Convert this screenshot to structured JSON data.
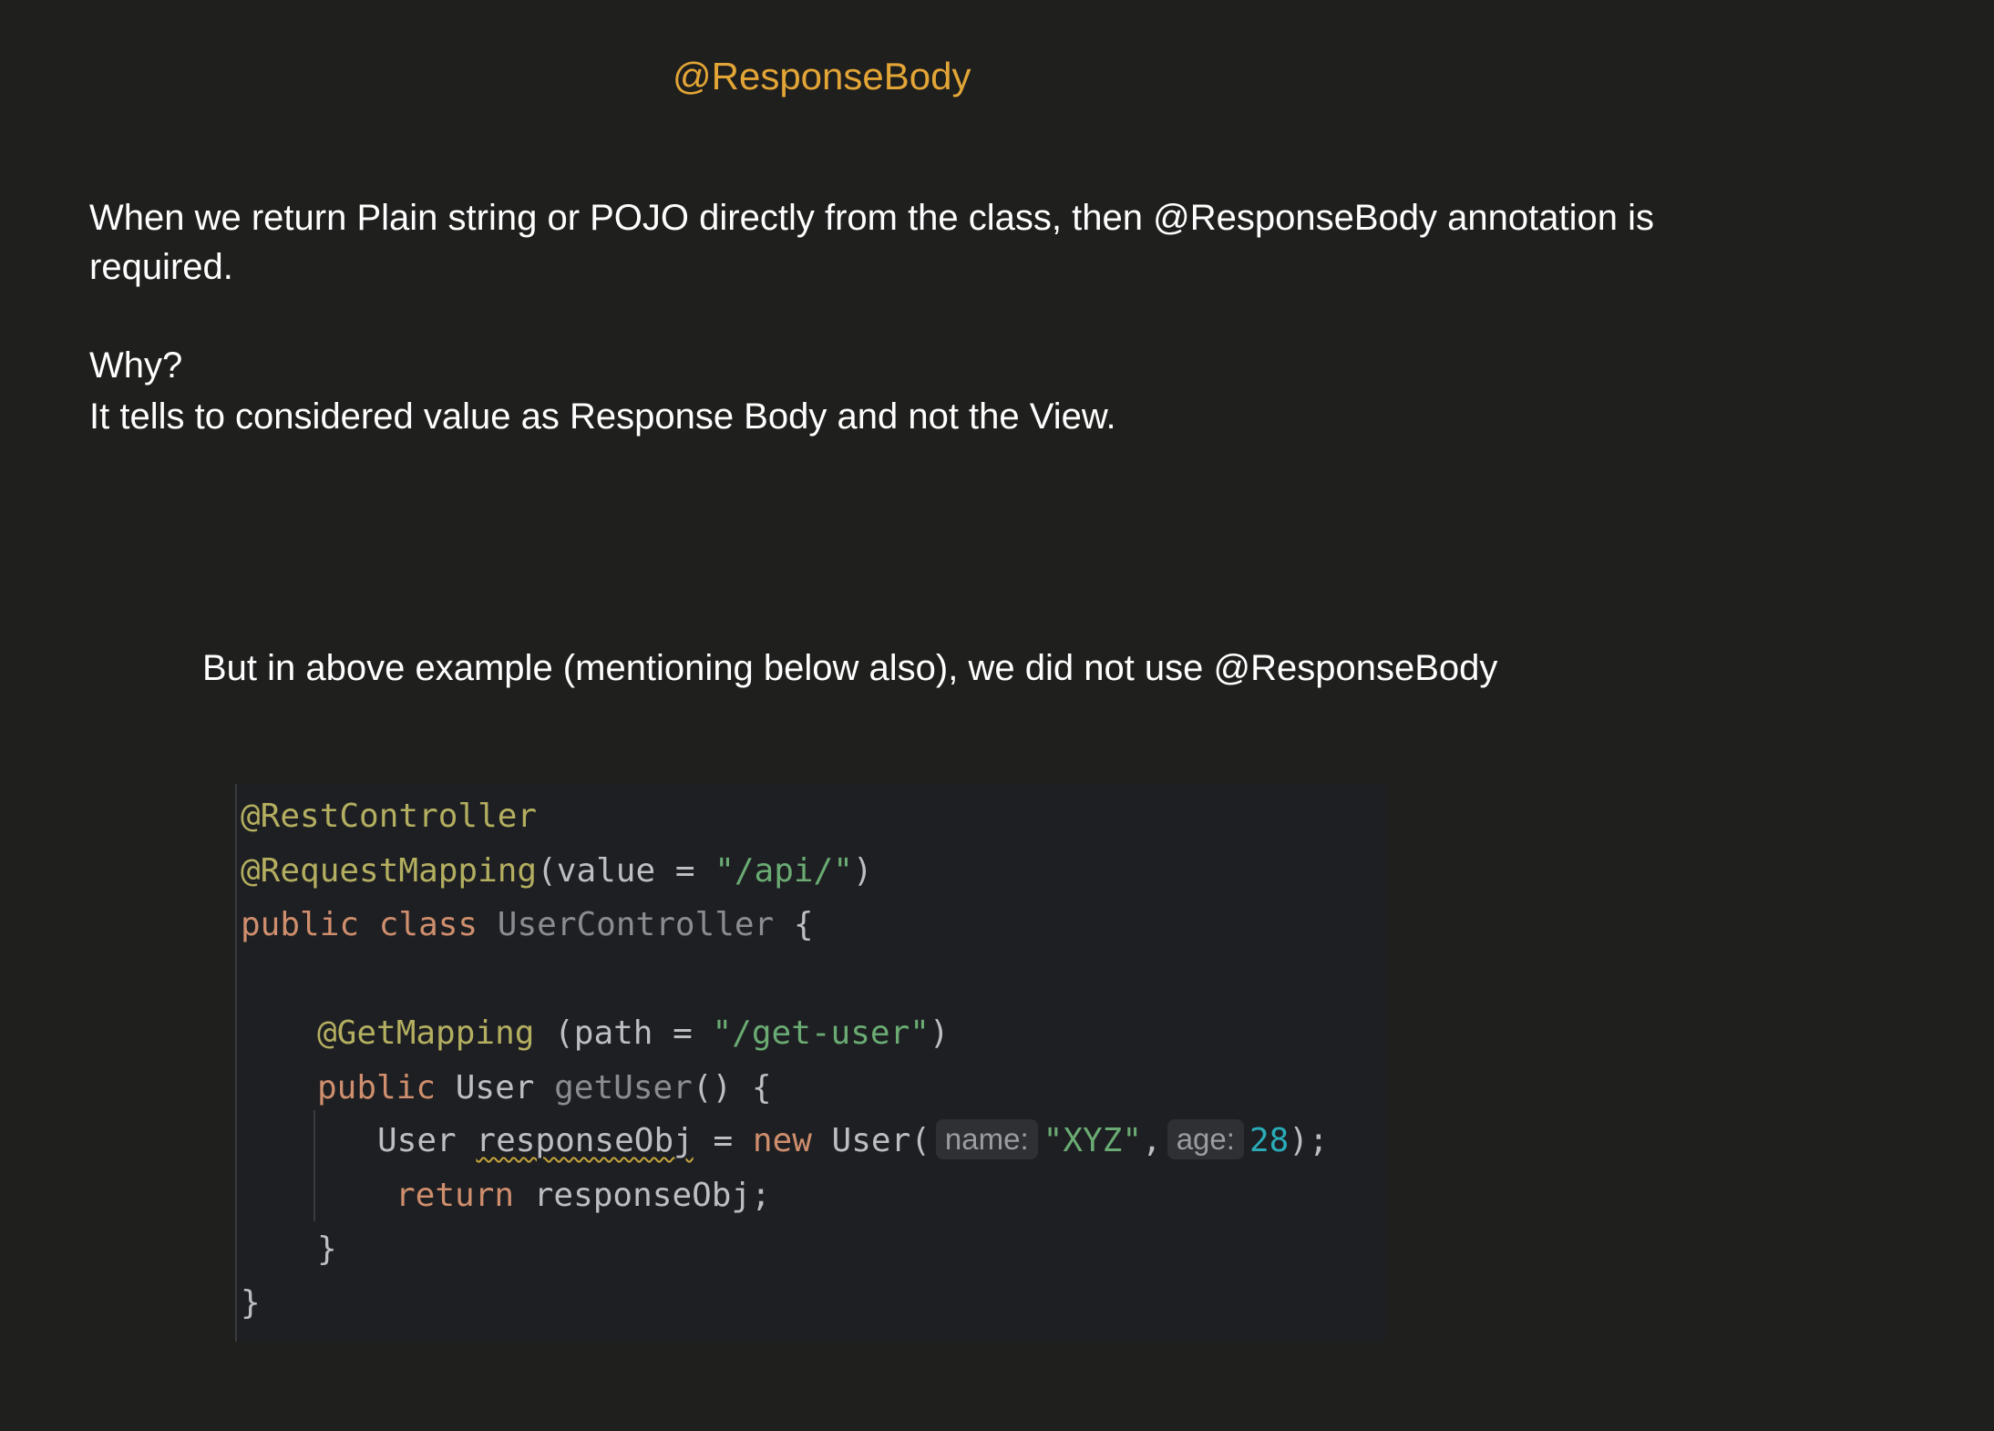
{
  "title": "@ResponseBody",
  "intro": {
    "line1": "When we return Plain string or POJO directly from the class, then @ResponseBody annotation is",
    "line2": "required."
  },
  "why": {
    "heading": "Why?",
    "answer": "It tells to considered value as Response Body and not the View."
  },
  "note": "But in above example (mentioning below also), we did not use @ResponseBody",
  "code": {
    "l1": {
      "ann": "@RestController"
    },
    "l2": {
      "ann": "@RequestMapping",
      "open": "(value = ",
      "str": "\"/api/\"",
      "close": ")"
    },
    "l3": {
      "kw1": "public",
      "kw2": "class",
      "cls": "UserController",
      "brace": "{"
    },
    "l4": {
      "ann": "@GetMapping",
      "open": " (path = ",
      "str": "\"/get-user\"",
      "close": ")"
    },
    "l5": {
      "kw": "public",
      "type": "User",
      "fn": "getUser",
      "rest": "() {"
    },
    "l6": {
      "type": "User",
      "var": "responseObj",
      "eq": " = ",
      "kw": "new",
      "ctor": " User(",
      "hint1": "name:",
      "str": "\"XYZ\"",
      "comma": ",",
      "hint2": "age:",
      "num": "28",
      "end": ");"
    },
    "l7": {
      "kw": "return",
      "rest": " responseObj;"
    },
    "l8": {
      "brace": "}"
    },
    "l9": {
      "brace": "}"
    }
  }
}
